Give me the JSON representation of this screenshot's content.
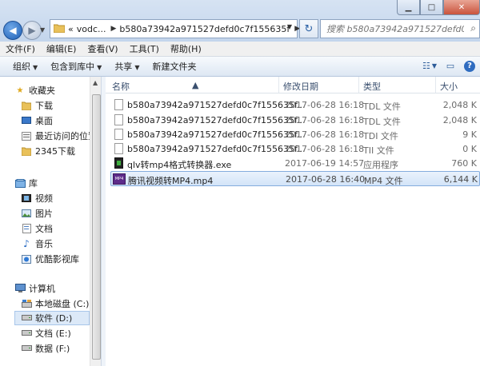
{
  "address": {
    "prefix": "«",
    "crumb1": "vodc...",
    "crumb2": "b580a73942a971527defd0c7f155635f"
  },
  "search": {
    "placeholder": "搜索 b580a73942a971527defd0c7f..."
  },
  "menu": [
    "文件(F)",
    "编辑(E)",
    "查看(V)",
    "工具(T)",
    "帮助(H)"
  ],
  "toolbar": {
    "organize": "组织",
    "include_in_library": "包含到库中",
    "share": "共享",
    "new_folder": "新建文件夹"
  },
  "nav": {
    "favorites": "收藏夹",
    "downloads": "下载",
    "desktop": "桌面",
    "recent": "最近访问的位置",
    "folder_2345": "2345下载",
    "libraries": "库",
    "videos": "视频",
    "pictures": "图片",
    "documents": "文档",
    "music": "音乐",
    "youku": "优酷影视库",
    "computer": "计算机",
    "drive_c": "本地磁盘 (C:)",
    "drive_d": "软件 (D:)",
    "drive_e": "文档 (E:)",
    "drive_f": "数据 (F:)"
  },
  "columns": {
    "name": "名称",
    "date": "修改日期",
    "type": "类型",
    "size": "大小"
  },
  "files": [
    {
      "name": "b580a73942a971527defd0c7f155635f...",
      "date": "2017-06-28 16:18",
      "type": "TDL 文件",
      "size": "2,048 K"
    },
    {
      "name": "b580a73942a971527defd0c7f155635f...",
      "date": "2017-06-28 16:18",
      "type": "TDL 文件",
      "size": "2,048 K"
    },
    {
      "name": "b580a73942a971527defd0c7f155635f...",
      "date": "2017-06-28 16:18",
      "type": "TDI 文件",
      "size": "9 K"
    },
    {
      "name": "b580a73942a971527defd0c7f155635f...",
      "date": "2017-06-28 16:18",
      "type": "TII 文件",
      "size": "0 K"
    },
    {
      "name": "qlv转mp4格式转换器.exe",
      "date": "2017-06-19 14:57",
      "type": "应用程序",
      "size": "760 K"
    },
    {
      "name": "腾讯视频转MP4.mp4",
      "date": "2017-06-28 16:40",
      "type": "MP4 文件",
      "size": "6,144 K"
    }
  ]
}
